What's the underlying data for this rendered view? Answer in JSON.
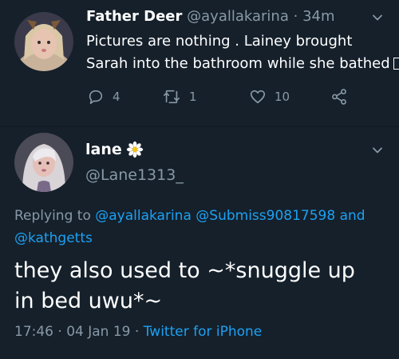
{
  "parent_tweet": {
    "name": "Father Deer",
    "handle": "@ayallakarina",
    "separator": "·",
    "time": "34m",
    "body_lines": [
      "Pictures are nothing . Lainey brought",
      "Sarah into the bathroom while she bathed"
    ],
    "reply_count": "4",
    "retweet_count": "1",
    "like_count": "10"
  },
  "focused_tweet": {
    "name": "lane",
    "handle": "@Lane1313_",
    "replying_prefix": "Replying to",
    "replying_to": [
      "@ayallakarina",
      "@Submiss90817598"
    ],
    "replying_and": "and",
    "replying_last": "@kathgetts",
    "body_lines": [
      "they also used to ~*snuggle up",
      "in bed uwu*~"
    ],
    "time": "17:46",
    "separator": "·",
    "date": "04 Jan 19",
    "source": "Twitter for iPhone"
  },
  "icons": {
    "reply": "reply-icon",
    "retweet": "retweet-icon",
    "like": "heart-icon",
    "share": "share-icon",
    "caret": "chevron-down-icon",
    "name_emoji": "daisy-icon"
  },
  "colors": {
    "background": "#15202b",
    "text": "#ffffff",
    "muted": "#8899a6",
    "accent": "#1da1f2"
  }
}
